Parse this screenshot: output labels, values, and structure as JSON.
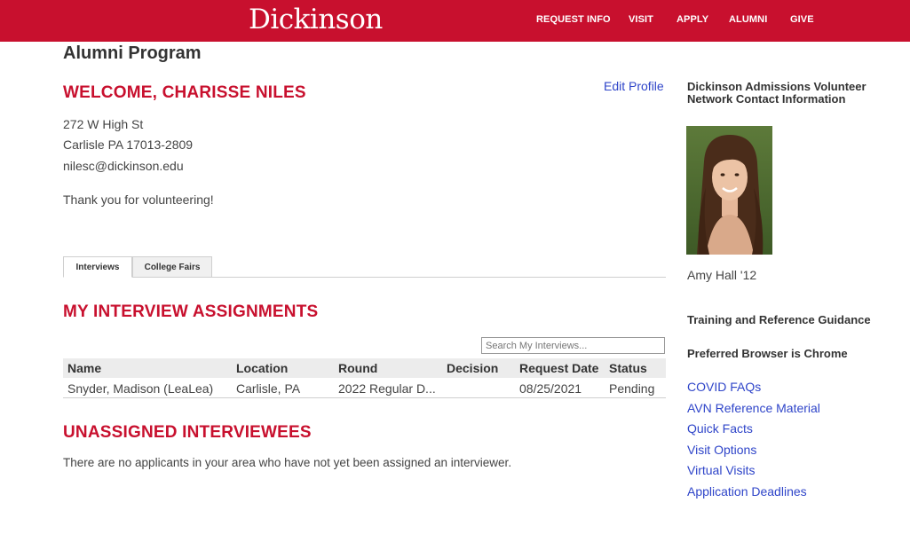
{
  "header": {
    "brand": "Dickinson",
    "nav": [
      "REQUEST INFO",
      "VISIT",
      "APPLY",
      "ALUMNI",
      "GIVE"
    ]
  },
  "page": {
    "title": "Alumni Program",
    "welcome": "WELCOME, CHARISSE NILES",
    "address_line1": "272 W High St",
    "address_line2": "Carlisle PA 17013-2809",
    "email": "nilesc@dickinson.edu",
    "thanks": "Thank you for volunteering!",
    "edit_profile": "Edit Profile"
  },
  "tabs": [
    {
      "label": "Interviews",
      "active": true
    },
    {
      "label": "College Fairs",
      "active": false
    }
  ],
  "assignments": {
    "heading": "MY INTERVIEW ASSIGNMENTS",
    "search_placeholder": "Search My Interviews...",
    "columns": [
      "Name",
      "Location",
      "Round",
      "Decision",
      "Request Date",
      "Status"
    ],
    "rows": [
      {
        "name": "Snyder, Madison (LeaLea)",
        "location": "Carlisle, PA",
        "round": "2022 Regular D...",
        "decision": "",
        "request_date": "08/25/2021",
        "status": "Pending"
      }
    ]
  },
  "unassigned": {
    "heading": "UNASSIGNED INTERVIEWEES",
    "message": "There are no applicants in your area who have not yet been assigned an interviewer."
  },
  "sidebar": {
    "contact_heading": "Dickinson Admissions Volunteer Network Contact Information",
    "contact_name": "Amy Hall '12",
    "training_heading": "Training and Reference Guidance",
    "browser_heading": "Preferred Browser is Chrome",
    "links": [
      "COVID FAQs",
      "AVN Reference Material",
      "Quick Facts",
      "Visit Options",
      "Virtual Visits",
      "Application Deadlines"
    ]
  },
  "colors": {
    "brand_red": "#c8102e",
    "link_blue": "#2f45c9"
  }
}
